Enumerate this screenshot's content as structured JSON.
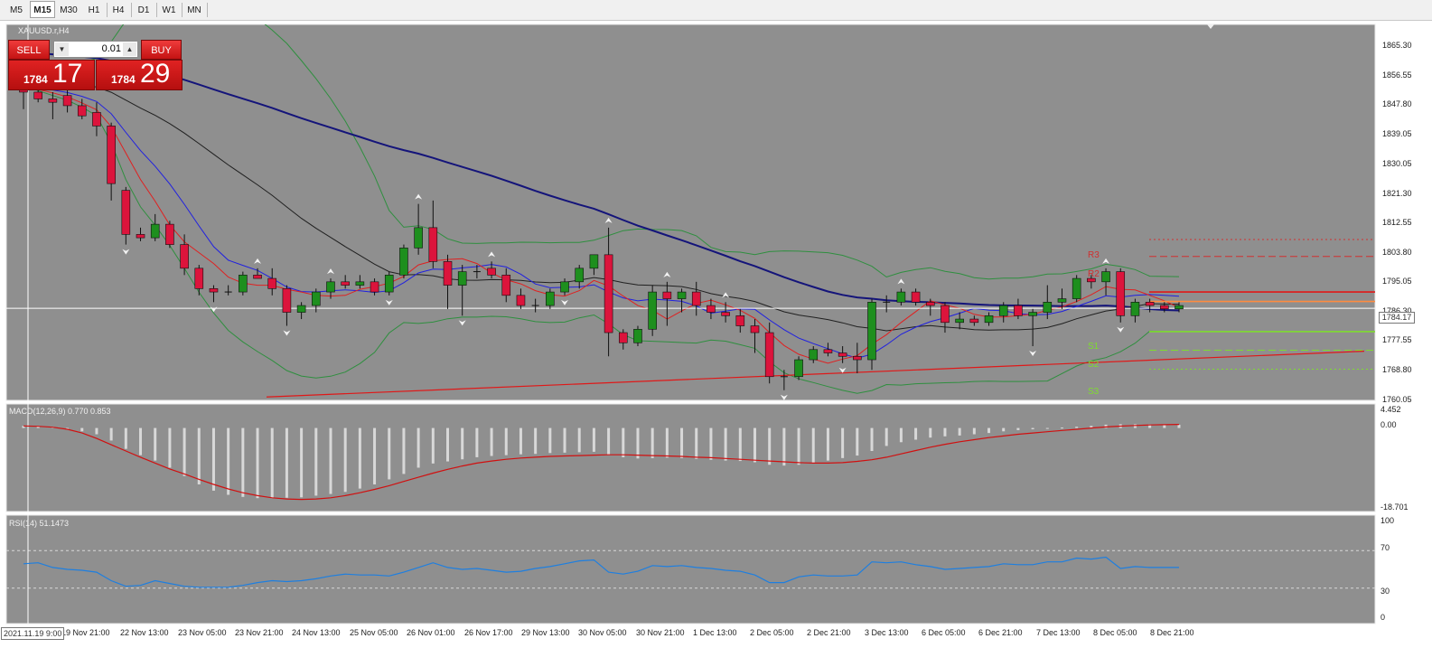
{
  "toolbar": {
    "timeframes": [
      {
        "label": "M5",
        "active": false
      },
      {
        "label": "M15",
        "active": true
      },
      {
        "label": "M30",
        "active": false
      },
      {
        "label": "H1",
        "active": false
      },
      {
        "label": "H4",
        "active": false
      },
      {
        "label": "D1",
        "active": false
      },
      {
        "label": "W1",
        "active": false
      },
      {
        "label": "MN",
        "active": false
      }
    ]
  },
  "chart": {
    "symbol": "XAUUSD.r,H4",
    "current_price": "1784.17",
    "cursor_date": "2021.11.19 9:00",
    "y_axis_labels": [
      "1865.30",
      "1856.55",
      "1847.80",
      "1839.05",
      "1830.05",
      "1821.30",
      "1812.55",
      "1803.80",
      "1795.05",
      "1786.30",
      "1777.55",
      "1768.80",
      "1760.05"
    ],
    "x_axis_labels": [
      "19 Nov 21:00",
      "22 Nov 13:00",
      "23 Nov 05:00",
      "23 Nov 21:00",
      "24 Nov 13:00",
      "25 Nov 05:00",
      "26 Nov 01:00",
      "26 Nov 17:00",
      "29 Nov 13:00",
      "30 Nov 05:00",
      "30 Nov 21:00",
      "1 Dec 13:00",
      "2 Dec 05:00",
      "2 Dec 21:00",
      "3 Dec 13:00",
      "6 Dec 05:00",
      "6 Dec 21:00",
      "7 Dec 13:00",
      "8 Dec 05:00",
      "8 Dec 21:00"
    ],
    "pivot_levels": [
      {
        "label": "R3",
        "color": "#d03030"
      },
      {
        "label": "R2",
        "color": "#d03030"
      },
      {
        "label": "S1",
        "color": "#7fdc2f"
      },
      {
        "label": "S2",
        "color": "#7fdc2f"
      },
      {
        "label": "S3",
        "color": "#7fdc2f"
      }
    ]
  },
  "trade_panel": {
    "sell_label": "SELL",
    "buy_label": "BUY",
    "lot": "0.01",
    "sell_price_small": "1784",
    "sell_price_big": "17",
    "buy_price_small": "1784",
    "buy_price_big": "29"
  },
  "macd": {
    "label": "MACD(12,26,9) 0.770 0.853",
    "axis": [
      "4.452",
      "0.00",
      "-18.701"
    ]
  },
  "rsi": {
    "label": "RSI(14) 51.1473",
    "axis": [
      "100",
      "70",
      "30",
      "0"
    ]
  },
  "colors": {
    "background": "#8f8f8f",
    "bull_candle": "#1e8f1e",
    "bear_candle": "#dc143c",
    "ma_slow": "#14147a",
    "ma_mid": "#202020",
    "ma_fast_red": "#e02020",
    "ma_fast_blue": "#2020e0",
    "bollinger": "#2f8f3f",
    "macd_signal": "#d01010",
    "rsi_line": "#1e7fe0"
  },
  "chart_data": {
    "type": "candlestick",
    "title": "XAUUSD.r,H4",
    "ylim": [
      1757,
      1868
    ],
    "candles": [
      {
        "o": 1850,
        "h": 1852,
        "l": 1843,
        "c": 1848
      },
      {
        "o": 1848,
        "h": 1850,
        "l": 1845,
        "c": 1846
      },
      {
        "o": 1846,
        "h": 1848,
        "l": 1840,
        "c": 1845
      },
      {
        "o": 1847,
        "h": 1849,
        "l": 1842,
        "c": 1844
      },
      {
        "o": 1844,
        "h": 1846,
        "l": 1840,
        "c": 1841
      },
      {
        "o": 1842,
        "h": 1845,
        "l": 1835,
        "c": 1838
      },
      {
        "o": 1838,
        "h": 1839,
        "l": 1816,
        "c": 1821
      },
      {
        "o": 1819,
        "h": 1820,
        "l": 1803,
        "c": 1806
      },
      {
        "o": 1806,
        "h": 1808,
        "l": 1804,
        "c": 1805
      },
      {
        "o": 1805,
        "h": 1812,
        "l": 1804,
        "c": 1809
      },
      {
        "o": 1809,
        "h": 1810,
        "l": 1802,
        "c": 1803
      },
      {
        "o": 1803,
        "h": 1806,
        "l": 1794,
        "c": 1796
      },
      {
        "o": 1796,
        "h": 1797,
        "l": 1788,
        "c": 1790
      },
      {
        "o": 1790,
        "h": 1791,
        "l": 1786,
        "c": 1789
      },
      {
        "o": 1789,
        "h": 1791,
        "l": 1788,
        "c": 1789
      },
      {
        "o": 1789,
        "h": 1795,
        "l": 1788,
        "c": 1794
      },
      {
        "o": 1794,
        "h": 1796,
        "l": 1793,
        "c": 1793
      },
      {
        "o": 1793,
        "h": 1796,
        "l": 1788,
        "c": 1790
      },
      {
        "o": 1790,
        "h": 1791,
        "l": 1779,
        "c": 1783
      },
      {
        "o": 1783,
        "h": 1786,
        "l": 1781,
        "c": 1785
      },
      {
        "o": 1785,
        "h": 1790,
        "l": 1783,
        "c": 1789
      },
      {
        "o": 1789,
        "h": 1793,
        "l": 1787,
        "c": 1792
      },
      {
        "o": 1792,
        "h": 1794,
        "l": 1790,
        "c": 1791
      },
      {
        "o": 1791,
        "h": 1794,
        "l": 1790,
        "c": 1792
      },
      {
        "o": 1792,
        "h": 1793,
        "l": 1788,
        "c": 1789
      },
      {
        "o": 1789,
        "h": 1795,
        "l": 1788,
        "c": 1794
      },
      {
        "o": 1794,
        "h": 1803,
        "l": 1793,
        "c": 1802
      },
      {
        "o": 1802,
        "h": 1815,
        "l": 1800,
        "c": 1808
      },
      {
        "o": 1808,
        "h": 1816,
        "l": 1796,
        "c": 1798
      },
      {
        "o": 1798,
        "h": 1800,
        "l": 1784,
        "c": 1791
      },
      {
        "o": 1791,
        "h": 1797,
        "l": 1782,
        "c": 1795
      },
      {
        "o": 1795,
        "h": 1797,
        "l": 1793,
        "c": 1795
      },
      {
        "o": 1796,
        "h": 1798,
        "l": 1793,
        "c": 1794
      },
      {
        "o": 1794,
        "h": 1796,
        "l": 1786,
        "c": 1788
      },
      {
        "o": 1788,
        "h": 1790,
        "l": 1784,
        "c": 1785
      },
      {
        "o": 1785,
        "h": 1787,
        "l": 1783,
        "c": 1785
      },
      {
        "o": 1785,
        "h": 1790,
        "l": 1784,
        "c": 1789
      },
      {
        "o": 1789,
        "h": 1793,
        "l": 1788,
        "c": 1792
      },
      {
        "o": 1792,
        "h": 1797,
        "l": 1790,
        "c": 1796
      },
      {
        "o": 1796,
        "h": 1800,
        "l": 1794,
        "c": 1800
      },
      {
        "o": 1800,
        "h": 1808,
        "l": 1770,
        "c": 1777
      },
      {
        "o": 1777,
        "h": 1778,
        "l": 1772,
        "c": 1774
      },
      {
        "o": 1774,
        "h": 1779,
        "l": 1773,
        "c": 1778
      },
      {
        "o": 1778,
        "h": 1791,
        "l": 1776,
        "c": 1789
      },
      {
        "o": 1789,
        "h": 1792,
        "l": 1779,
        "c": 1787
      },
      {
        "o": 1787,
        "h": 1790,
        "l": 1783,
        "c": 1789
      },
      {
        "o": 1789,
        "h": 1792,
        "l": 1782,
        "c": 1785
      },
      {
        "o": 1785,
        "h": 1787,
        "l": 1781,
        "c": 1783
      },
      {
        "o": 1783,
        "h": 1786,
        "l": 1780,
        "c": 1782
      },
      {
        "o": 1782,
        "h": 1784,
        "l": 1777,
        "c": 1779
      },
      {
        "o": 1779,
        "h": 1781,
        "l": 1771,
        "c": 1777
      },
      {
        "o": 1777,
        "h": 1780,
        "l": 1762,
        "c": 1764
      },
      {
        "o": 1764,
        "h": 1766,
        "l": 1760,
        "c": 1764
      },
      {
        "o": 1764,
        "h": 1770,
        "l": 1763,
        "c": 1769
      },
      {
        "o": 1769,
        "h": 1773,
        "l": 1768,
        "c": 1772
      },
      {
        "o": 1772,
        "h": 1774,
        "l": 1770,
        "c": 1771
      },
      {
        "o": 1771,
        "h": 1773,
        "l": 1768,
        "c": 1770
      },
      {
        "o": 1770,
        "h": 1774,
        "l": 1765,
        "c": 1769
      },
      {
        "o": 1769,
        "h": 1787,
        "l": 1766,
        "c": 1786
      },
      {
        "o": 1786,
        "h": 1788,
        "l": 1783,
        "c": 1786
      },
      {
        "o": 1786,
        "h": 1790,
        "l": 1785,
        "c": 1789
      },
      {
        "o": 1789,
        "h": 1790,
        "l": 1785,
        "c": 1786
      },
      {
        "o": 1786,
        "h": 1787,
        "l": 1782,
        "c": 1785
      },
      {
        "o": 1785,
        "h": 1786,
        "l": 1777,
        "c": 1780
      },
      {
        "o": 1780,
        "h": 1783,
        "l": 1778,
        "c": 1781
      },
      {
        "o": 1781,
        "h": 1782,
        "l": 1779,
        "c": 1780
      },
      {
        "o": 1780,
        "h": 1783,
        "l": 1779,
        "c": 1782
      },
      {
        "o": 1782,
        "h": 1786,
        "l": 1780,
        "c": 1785
      },
      {
        "o": 1785,
        "h": 1787,
        "l": 1781,
        "c": 1782
      },
      {
        "o": 1782,
        "h": 1784,
        "l": 1773,
        "c": 1783
      },
      {
        "o": 1783,
        "h": 1791,
        "l": 1781,
        "c": 1786
      },
      {
        "o": 1786,
        "h": 1790,
        "l": 1784,
        "c": 1787
      },
      {
        "o": 1787,
        "h": 1794,
        "l": 1786,
        "c": 1793
      },
      {
        "o": 1793,
        "h": 1794,
        "l": 1790,
        "c": 1792
      },
      {
        "o": 1792,
        "h": 1796,
        "l": 1788,
        "c": 1795
      },
      {
        "o": 1795,
        "h": 1796,
        "l": 1780,
        "c": 1782
      },
      {
        "o": 1782,
        "h": 1787,
        "l": 1780,
        "c": 1786
      },
      {
        "o": 1786,
        "h": 1787,
        "l": 1783,
        "c": 1785
      },
      {
        "o": 1785,
        "h": 1786,
        "l": 1783,
        "c": 1784
      },
      {
        "o": 1784,
        "h": 1786,
        "l": 1783,
        "c": 1785
      }
    ],
    "macd_histogram": [
      0.5,
      0.5,
      0.3,
      -0.2,
      -0.8,
      -1.5,
      -3,
      -5,
      -6.5,
      -7.8,
      -9.5,
      -11.5,
      -13.5,
      -15,
      -16,
      -16.5,
      -16.8,
      -16.8,
      -16.7,
      -16.6,
      -16.2,
      -15.8,
      -15.3,
      -14.5,
      -13.5,
      -12.3,
      -11,
      -9.5,
      -8.5,
      -8,
      -7.5,
      -7,
      -6.7,
      -6.5,
      -6.3,
      -6.2,
      -6,
      -5.9,
      -5.8,
      -5.7,
      -6.5,
      -7,
      -7.3,
      -7.2,
      -7.1,
      -7.2,
      -7.4,
      -7.6,
      -7.8,
      -7.9,
      -8.2,
      -8.8,
      -9,
      -8.8,
      -8.4,
      -7.8,
      -7.2,
      -6.6,
      -5.5,
      -4.3,
      -3.4,
      -2.8,
      -2.3,
      -2,
      -1.8,
      -1.5,
      -1.2,
      -0.8,
      -0.5,
      -0.3,
      -0.1,
      0.1,
      0.3,
      0.5,
      0.8,
      0.9,
      0.9,
      0.85,
      0.8,
      0.77
    ],
    "macd_signal": [
      0.5,
      0.4,
      0.2,
      -0.3,
      -1.2,
      -2.5,
      -4,
      -5.5,
      -7,
      -8.4,
      -9.8,
      -11,
      -12.3,
      -13.5,
      -14.6,
      -15.5,
      -16.2,
      -16.7,
      -17,
      -17.1,
      -17,
      -16.7,
      -16.2,
      -15.5,
      -14.7,
      -13.8,
      -12.8,
      -11.8,
      -10.8,
      -9.9,
      -9.1,
      -8.4,
      -7.9,
      -7.5,
      -7.2,
      -7,
      -6.8,
      -6.7,
      -6.6,
      -6.5,
      -6.4,
      -6.4,
      -6.5,
      -6.6,
      -6.7,
      -6.8,
      -7,
      -7.1,
      -7.3,
      -7.5,
      -7.7,
      -7.9,
      -8.1,
      -8.3,
      -8.4,
      -8.4,
      -8.3,
      -8,
      -7.6,
      -7,
      -6.2,
      -5.4,
      -4.6,
      -3.9,
      -3.3,
      -2.8,
      -2.3,
      -1.9,
      -1.5,
      -1.2,
      -0.9,
      -0.6,
      -0.3,
      0,
      0.25,
      0.45,
      0.6,
      0.72,
      0.8,
      0.85
    ],
    "rsi": [
      56,
      57,
      52,
      50,
      49,
      47,
      38,
      32,
      33,
      38,
      35,
      32,
      31,
      31,
      31,
      33,
      36,
      38,
      37,
      38,
      40,
      43,
      45,
      44,
      44,
      43,
      47,
      52,
      57,
      52,
      50,
      51,
      49,
      47,
      48,
      51,
      53,
      56,
      59,
      60,
      47,
      45,
      48,
      54,
      53,
      54,
      52,
      51,
      49,
      48,
      44,
      36,
      36,
      42,
      44,
      43,
      43,
      44,
      58,
      57,
      58,
      55,
      53,
      50,
      51,
      52,
      53,
      56,
      55,
      55,
      58,
      58,
      62,
      61,
      63,
      51,
      53,
      52,
      52,
      52
    ]
  }
}
